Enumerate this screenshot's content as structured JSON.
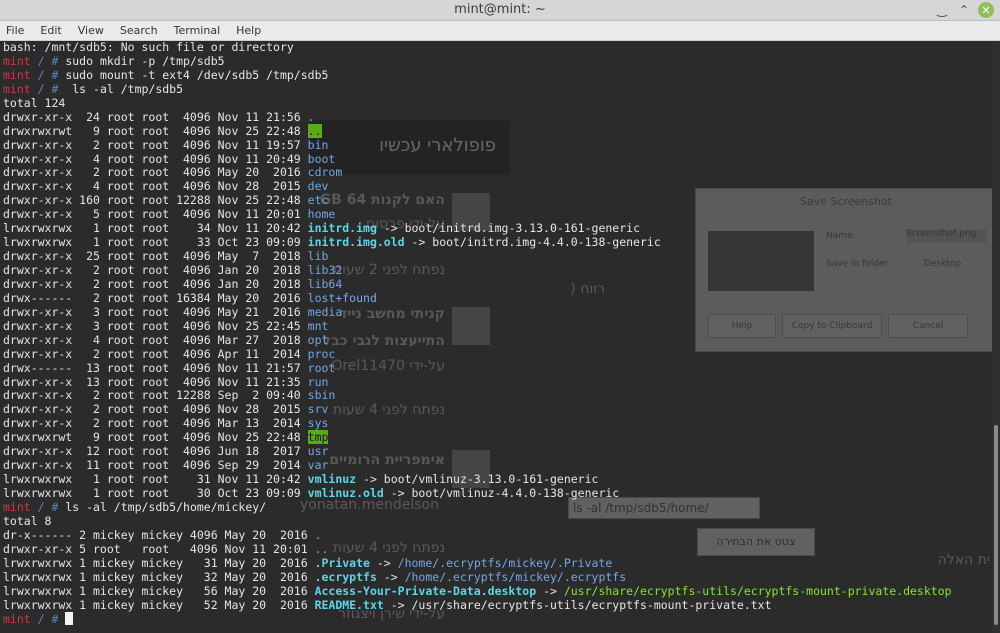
{
  "window": {
    "title": "mint@mint: ~"
  },
  "window_controls": {
    "minimize": "‿",
    "maximize": "⌃",
    "close": "✕"
  },
  "menu": [
    "File",
    "Edit",
    "View",
    "Search",
    "Terminal",
    "Help"
  ],
  "terminal": {
    "lines": [
      [
        {
          "t": "bash: /mnt/sdb5: No such file or directory",
          "c": ""
        }
      ],
      [
        {
          "t": "mint",
          "c": "c-prompt"
        },
        {
          "t": " / # ",
          "c": "c-sep"
        },
        {
          "t": "sudo mkdir -p /tmp/sdb5",
          "c": ""
        }
      ],
      [
        {
          "t": "mint",
          "c": "c-prompt"
        },
        {
          "t": " / # ",
          "c": "c-sep"
        },
        {
          "t": "sudo mount -t ext4 /dev/sdb5 /tmp/sdb5",
          "c": ""
        }
      ],
      [
        {
          "t": "mint",
          "c": "c-prompt"
        },
        {
          "t": " / # ",
          "c": "c-sep"
        },
        {
          "t": " ls -al /tmp/sdb5",
          "c": ""
        }
      ],
      [
        {
          "t": "total 124",
          "c": ""
        }
      ],
      [
        {
          "t": "drwxr-xr-x  24 root root  4096 Nov 11 21:56 ",
          "c": ""
        },
        {
          "t": ".",
          "c": "c-dir"
        }
      ],
      [
        {
          "t": "drwxrwxrwt   9 root root  4096 Nov 25 22:48 ",
          "c": ""
        },
        {
          "t": "..",
          "c": "c-sticky"
        }
      ],
      [
        {
          "t": "drwxr-xr-x   2 root root  4096 Nov 11 19:57 ",
          "c": ""
        },
        {
          "t": "bin",
          "c": "c-dir"
        }
      ],
      [
        {
          "t": "drwxr-xr-x   4 root root  4096 Nov 11 20:49 ",
          "c": ""
        },
        {
          "t": "boot",
          "c": "c-dir"
        }
      ],
      [
        {
          "t": "drwxr-xr-x   2 root root  4096 May 20  2016 ",
          "c": ""
        },
        {
          "t": "cdrom",
          "c": "c-dir"
        }
      ],
      [
        {
          "t": "drwxr-xr-x   4 root root  4096 Nov 28  2015 ",
          "c": ""
        },
        {
          "t": "dev",
          "c": "c-dir"
        }
      ],
      [
        {
          "t": "drwxr-xr-x 160 root root 12288 Nov 25 22:48 ",
          "c": ""
        },
        {
          "t": "etc",
          "c": "c-dir"
        }
      ],
      [
        {
          "t": "drwxr-xr-x   5 root root  4096 Nov 11 20:01 ",
          "c": ""
        },
        {
          "t": "home",
          "c": "c-dir"
        }
      ],
      [
        {
          "t": "lrwxrwxrwx   1 root root    34 Nov 11 20:42 ",
          "c": ""
        },
        {
          "t": "initrd.img",
          "c": "c-link"
        },
        {
          "t": " -> boot/initrd.img-3.13.0-161-generic",
          "c": ""
        }
      ],
      [
        {
          "t": "lrwxrwxrwx   1 root root    33 Oct 23 09:09 ",
          "c": ""
        },
        {
          "t": "initrd.img.old",
          "c": "c-link"
        },
        {
          "t": " -> boot/initrd.img-4.4.0-138-generic",
          "c": ""
        }
      ],
      [
        {
          "t": "drwxr-xr-x  25 root root  4096 May  7  2018 ",
          "c": ""
        },
        {
          "t": "lib",
          "c": "c-dir"
        }
      ],
      [
        {
          "t": "drwxr-xr-x   2 root root  4096 Jan 20  2018 ",
          "c": ""
        },
        {
          "t": "lib32",
          "c": "c-dir"
        }
      ],
      [
        {
          "t": "drwxr-xr-x   2 root root  4096 Jan 20  2018 ",
          "c": ""
        },
        {
          "t": "lib64",
          "c": "c-dir"
        }
      ],
      [
        {
          "t": "drwx------   2 root root 16384 May 20  2016 ",
          "c": ""
        },
        {
          "t": "lost+found",
          "c": "c-dir"
        }
      ],
      [
        {
          "t": "drwxr-xr-x   3 root root  4096 May 21  2016 ",
          "c": ""
        },
        {
          "t": "media",
          "c": "c-dir"
        }
      ],
      [
        {
          "t": "drwxr-xr-x   3 root root  4096 Nov 25 22:45 ",
          "c": ""
        },
        {
          "t": "mnt",
          "c": "c-dir"
        }
      ],
      [
        {
          "t": "drwxr-xr-x   4 root root  4096 Mar 27  2018 ",
          "c": ""
        },
        {
          "t": "opt",
          "c": "c-dir"
        }
      ],
      [
        {
          "t": "drwxr-xr-x   2 root root  4096 Apr 11  2014 ",
          "c": ""
        },
        {
          "t": "proc",
          "c": "c-dir"
        }
      ],
      [
        {
          "t": "drwx------  13 root root  4096 Nov 11 21:57 ",
          "c": ""
        },
        {
          "t": "root",
          "c": "c-dir"
        }
      ],
      [
        {
          "t": "drwxr-xr-x  13 root root  4096 Nov 11 21:35 ",
          "c": ""
        },
        {
          "t": "run",
          "c": "c-dir"
        }
      ],
      [
        {
          "t": "drwxr-xr-x   2 root root 12288 Sep  2 09:40 ",
          "c": ""
        },
        {
          "t": "sbin",
          "c": "c-dir"
        }
      ],
      [
        {
          "t": "drwxr-xr-x   2 root root  4096 Nov 28  2015 ",
          "c": ""
        },
        {
          "t": "srv",
          "c": "c-dir"
        }
      ],
      [
        {
          "t": "drwxr-xr-x   2 root root  4096 Mar 13  2014 ",
          "c": ""
        },
        {
          "t": "sys",
          "c": "c-dir"
        }
      ],
      [
        {
          "t": "drwxrwxrwt   9 root root  4096 Nov 25 22:48 ",
          "c": ""
        },
        {
          "t": "tmp",
          "c": "c-sticky"
        }
      ],
      [
        {
          "t": "drwxr-xr-x  12 root root  4096 Jun 18  2017 ",
          "c": ""
        },
        {
          "t": "usr",
          "c": "c-dir"
        }
      ],
      [
        {
          "t": "drwxr-xr-x  11 root root  4096 Sep 29  2014 ",
          "c": ""
        },
        {
          "t": "var",
          "c": "c-dir"
        }
      ],
      [
        {
          "t": "lrwxrwxrwx   1 root root    31 Nov 11 20:42 ",
          "c": ""
        },
        {
          "t": "vmlinuz",
          "c": "c-link"
        },
        {
          "t": " -> boot/vmlinuz-3.13.0-161-generic",
          "c": ""
        }
      ],
      [
        {
          "t": "lrwxrwxrwx   1 root root    30 Oct 23 09:09 ",
          "c": ""
        },
        {
          "t": "vmlinuz.old",
          "c": "c-link"
        },
        {
          "t": " -> boot/vmlinuz-4.4.0-138-generic",
          "c": ""
        }
      ],
      [
        {
          "t": "mint",
          "c": "c-prompt"
        },
        {
          "t": " / # ",
          "c": "c-sep"
        },
        {
          "t": "ls -al /tmp/sdb5/home/mickey/",
          "c": ""
        }
      ],
      [
        {
          "t": "total 8",
          "c": ""
        }
      ],
      [
        {
          "t": "dr-x------ 2 mickey mickey 4096 May 20  2016 ",
          "c": ""
        },
        {
          "t": ".",
          "c": "c-dir"
        }
      ],
      [
        {
          "t": "drwxr-xr-x 5 root   root   4096 Nov 11 20:01 ",
          "c": ""
        },
        {
          "t": "..",
          "c": "c-dir"
        }
      ],
      [
        {
          "t": "lrwxrwxrwx 1 mickey mickey   31 May 20  2016 ",
          "c": ""
        },
        {
          "t": ".Private",
          "c": "c-link"
        },
        {
          "t": " -> ",
          "c": ""
        },
        {
          "t": "/home/.ecryptfs/mickey/.Private",
          "c": "c-hidden"
        }
      ],
      [
        {
          "t": "lrwxrwxrwx 1 mickey mickey   32 May 20  2016 ",
          "c": ""
        },
        {
          "t": ".ecryptfs",
          "c": "c-link"
        },
        {
          "t": " -> ",
          "c": ""
        },
        {
          "t": "/home/.ecryptfs/mickey/.ecryptfs",
          "c": "c-hidden"
        }
      ],
      [
        {
          "t": "lrwxrwxrwx 1 mickey mickey   56 May 20  2016 ",
          "c": ""
        },
        {
          "t": "Access-Your-Private-Data.desktop",
          "c": "c-link"
        },
        {
          "t": " -> ",
          "c": ""
        },
        {
          "t": "/usr/share/ecryptfs-utils/ecryptfs-mount-private.desktop",
          "c": "c-green"
        }
      ],
      [
        {
          "t": "lrwxrwxrwx 1 mickey mickey   52 May 20  2016 ",
          "c": ""
        },
        {
          "t": "README.txt",
          "c": "c-link"
        },
        {
          "t": " -> /usr/share/ecryptfs-utils/ecryptfs-mount-private.txt",
          "c": ""
        }
      ],
      [
        {
          "t": "mint",
          "c": "c-prompt"
        },
        {
          "t": " / # ",
          "c": "c-sep"
        }
      ]
    ]
  },
  "background_page": {
    "header": "פופולארי עכשיו",
    "items": [
      {
        "title": "האם לקנות 64 GB",
        "author": "על-ידי פרסום",
        "time": "נפתח לפני 2 שעות"
      },
      {
        "title": "קניתי מחשב נייד",
        "subtitle": "התייעצות לגבי כבל",
        "author": "על-ידי Orel11470",
        "time": "נפתח לפני 4 שעות"
      },
      {
        "title": "אימפריית הרומיים",
        "author": "yonatan.mendelson",
        "time": "נפתח לפני 4 שעות"
      }
    ],
    "author_prefix": "על-ידי שירן ויצגוזר",
    "share_label": "רווח",
    "side_label": "ית האלה",
    "copy_field": "ls -al /tmp/sdb5/home/",
    "copy_button": "צטט את הבחירה",
    "dialog": {
      "title": "Save Screenshot",
      "name_label": "Name:",
      "name_value": "Screenshot.png",
      "folder_label": "Save in folder:",
      "folder_value": "Desktop",
      "buttons": [
        "Help",
        "Copy to Clipboard",
        "Cancel"
      ]
    }
  }
}
